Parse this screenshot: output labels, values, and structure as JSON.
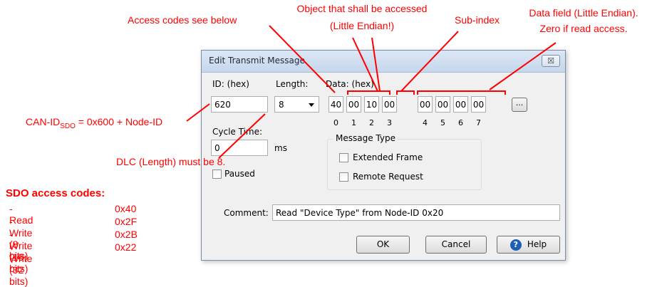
{
  "dialog": {
    "title": "Edit Transmit Message",
    "close_glyph": "☒",
    "id_label": "ID: (hex)",
    "id_value": "620",
    "length_label": "Length:",
    "length_value": "8",
    "data_label": "Data: (hex)",
    "data_bytes": [
      "40",
      "00",
      "10",
      "00",
      "00",
      "00",
      "00",
      "00"
    ],
    "data_indices": [
      "0",
      "1",
      "2",
      "3",
      "4",
      "5",
      "6",
      "7"
    ],
    "more_button": "...",
    "cycle_label": "Cycle Time:",
    "cycle_value": "0",
    "cycle_unit": "ms",
    "paused_label": "Paused",
    "msg_type_label": "Message Type",
    "extended_label": "Extended Frame",
    "remote_label": "Remote Request",
    "comment_label": "Comment:",
    "comment_value": "Read \"Device Type\" from Node-ID 0x20",
    "ok_label": "OK",
    "cancel_label": "Cancel",
    "help_label": "Help"
  },
  "annotations": {
    "access_codes": "Access codes see below",
    "object_line1": "Object that shall be accessed",
    "object_line2": "(Little Endian!)",
    "subindex": "Sub-index",
    "datafield_line1": "Data field (Little Endian).",
    "datafield_line2": "Zero if read access.",
    "canid_prefix": "CAN-ID",
    "canid_sub": "SDO",
    "canid_suffix": " = 0x600 + Node-ID",
    "dlc": "DLC (Length) must be 8."
  },
  "sdo": {
    "title": "SDO access codes:",
    "rows": [
      {
        "name": "-  Read",
        "value": "0x40"
      },
      {
        "name": "-  Write (8 bits)",
        "value": "0x2F"
      },
      {
        "name": "-  Write (16 bits)",
        "value": "0x2B"
      },
      {
        "name": "-  Write (32 bits)",
        "value": "0x22"
      }
    ]
  },
  "colors": {
    "annotation": "#ff0000",
    "dialog_bg": "#f0f0f0",
    "help_icon": "#1e5fb4"
  }
}
